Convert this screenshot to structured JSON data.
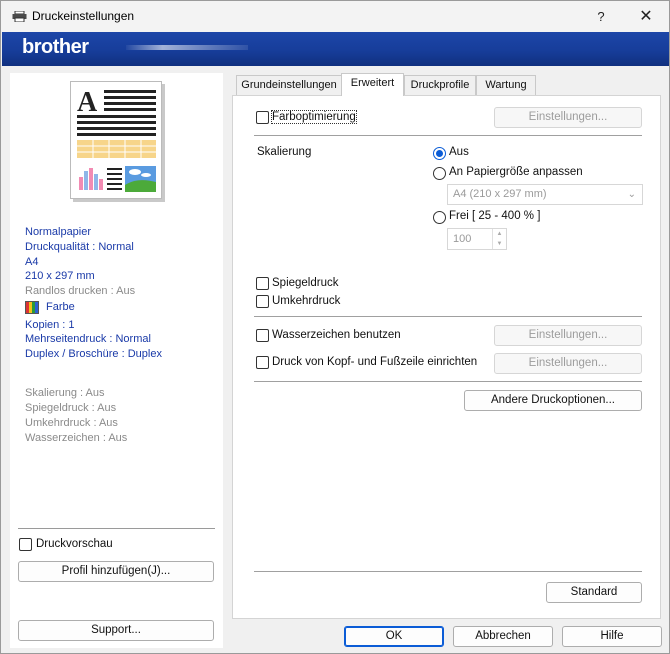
{
  "window": {
    "title": "Druckeinstellungen",
    "help": "?",
    "close": "✕"
  },
  "banner": {
    "logo": "brother"
  },
  "summary": {
    "paper": "Normalpapier",
    "quality": "Druckqualität : Normal",
    "size": "A4",
    "dimensions": "210 x 297 mm",
    "borderless": "Randlos drucken : Aus",
    "color": "Farbe",
    "copies": "Kopien : 1",
    "multipage": "Mehrseitendruck : Normal",
    "duplex": "Duplex / Broschüre : Duplex",
    "scaling": "Skalierung : Aus",
    "mirror": "Spiegeldruck : Aus",
    "reverse": "Umkehrdruck : Aus",
    "watermark": "Wasserzeichen : Aus"
  },
  "left": {
    "preview_label": "Druckvorschau",
    "add_profile": "Profil hinzufügen(J)...",
    "support": "Support..."
  },
  "tabs": [
    "Grundeinstellungen",
    "Erweitert",
    "Druckprofile",
    "Wartung"
  ],
  "advanced": {
    "color_opt": "Farboptimierung",
    "settings": "Einstellungen...",
    "scaling_label": "Skalierung",
    "scale_off": "Aus",
    "scale_fit": "An Papiergröße anpassen",
    "paper_select": "A4 (210 x 297 mm)",
    "scale_free": "Frei [ 25 - 400 % ]",
    "free_value": "100",
    "mirror": "Spiegeldruck",
    "reverse": "Umkehrdruck",
    "watermark": "Wasserzeichen benutzen",
    "header_footer": "Druck von Kopf- und Fußzeile einrichten",
    "other_options": "Andere Druckoptionen...",
    "standard": "Standard"
  },
  "footer": {
    "ok": "OK",
    "cancel": "Abbrechen",
    "help": "Hilfe"
  },
  "colors": {
    "accent": "#0b5cd6",
    "banner": "#173d9a",
    "summary_text": "#1a3aa8",
    "muted": "#8a8a8a"
  }
}
